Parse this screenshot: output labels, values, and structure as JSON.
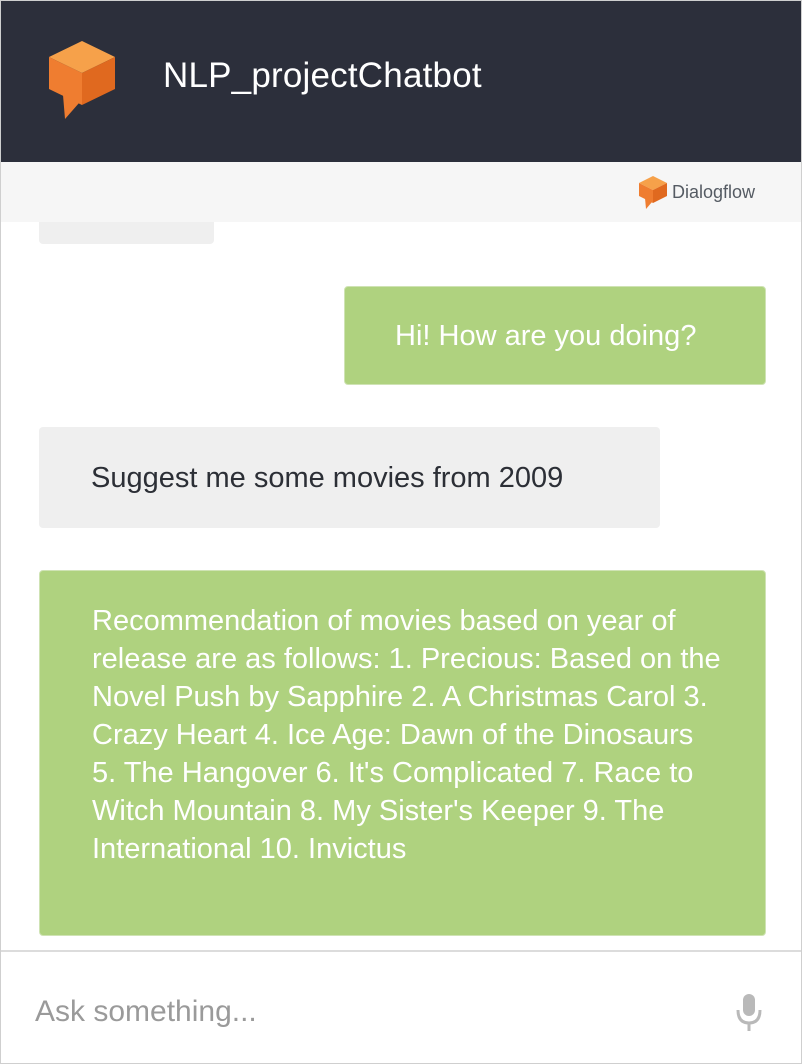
{
  "header": {
    "title": "NLP_projectChatbot",
    "logo_icon": "dialogflow-logo-icon",
    "background_color": "#2c2f3b"
  },
  "powered_by": {
    "label": "Dialogflow",
    "icon": "dialogflow-small-logo-icon"
  },
  "colors": {
    "user_bubble": "#afd27f",
    "bot_bubble": "#efefef",
    "logo_orange": "#ef7d30"
  },
  "messages": [
    {
      "sender": "user",
      "text": "Hi! How are you doing?"
    },
    {
      "sender": "bot",
      "text": "Suggest me some movies from 2009"
    },
    {
      "sender": "user",
      "text": "Recommendation of movies based on year of release are as follows: 1. Precious: Based on the Novel Push by Sapphire 2. A Christmas Carol 3. Crazy Heart 4. Ice Age: Dawn of the Dinosaurs 5. The Hangover 6. It's Complicated 7. Race to Witch Mountain 8. My Sister's Keeper 9. The International 10. Invictus"
    }
  ],
  "input": {
    "placeholder": "Ask something...",
    "value": "",
    "mic_icon": "microphone-icon"
  }
}
